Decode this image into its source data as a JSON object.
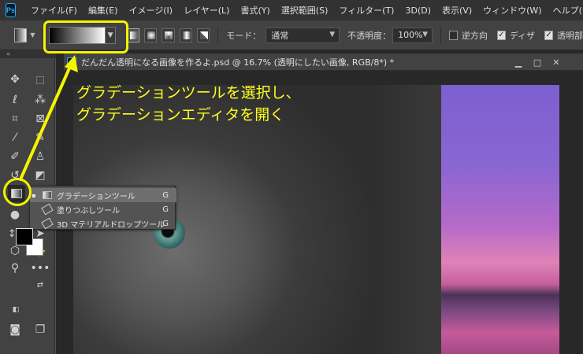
{
  "menu": {
    "items": [
      "ファイル(F)",
      "編集(E)",
      "イメージ(I)",
      "レイヤー(L)",
      "書式(Y)",
      "選択範囲(S)",
      "フィルター(T)",
      "3D(D)",
      "表示(V)",
      "ウィンドウ(W)",
      "ヘルプ(H)"
    ]
  },
  "app": {
    "logo": "Ps"
  },
  "options": {
    "mode_label": "モード：",
    "mode_value": "通常",
    "opacity_label": "不透明度：",
    "opacity_value": "100%",
    "reverse_label": "逆方向",
    "dither_label": "ディザ",
    "transparency_label": "透明部"
  },
  "panel": {
    "collapse_glyph": "«"
  },
  "document": {
    "title": "だんだん透明になる画像を作るよ.psd @ 16.7% (透明にしたい画像, RGB/8*) *"
  },
  "flyout": {
    "items": [
      {
        "label": "グラデーションツール",
        "key": "G",
        "active": true
      },
      {
        "label": "塗りつぶしツール",
        "key": "G",
        "active": false
      },
      {
        "label": "3D マテリアルドロップツール",
        "key": "G",
        "active": false
      }
    ]
  },
  "annotation": {
    "line1": "グラデーションツールを選択し、",
    "line2": "グラデーションエディタを開く",
    "color": "#ffff1e"
  },
  "colors": {
    "foreground": "#000000",
    "background": "#ffffff",
    "highlight": "#f4f400"
  }
}
